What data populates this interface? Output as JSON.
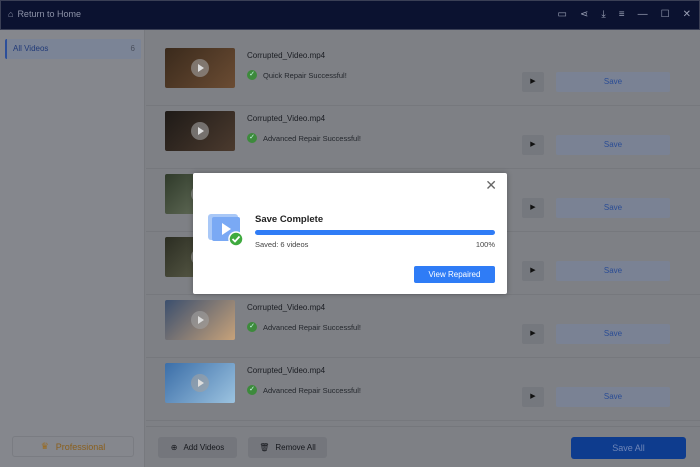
{
  "titlebar": {
    "home_label": "Return to Home",
    "icons": [
      "feedback-icon",
      "share-icon",
      "download-icon",
      "menu-icon",
      "minimize-icon",
      "maximize-icon",
      "close-icon"
    ]
  },
  "sidebar": {
    "all_videos_label": "All Videos",
    "all_videos_count": "6",
    "professional_label": "Professional"
  },
  "videos": [
    {
      "name": "Corrupted_Video.mp4",
      "status": "Quick Repair Successful!",
      "save": "Save"
    },
    {
      "name": "Corrupted_Video.mp4",
      "status": "Advanced Repair Successful!",
      "save": "Save"
    },
    {
      "name": "",
      "status": "",
      "save": "Save"
    },
    {
      "name": "",
      "status": "",
      "save": "Save"
    },
    {
      "name": "Corrupted_Video.mp4",
      "status": "Advanced Repair Successful!",
      "save": "Save"
    },
    {
      "name": "Corrupted_Video.mp4",
      "status": "Advanced Repair Successful!",
      "save": "Save"
    }
  ],
  "footer": {
    "add_videos": "Add Videos",
    "remove_all": "Remove All",
    "save_all": "Save All"
  },
  "modal": {
    "title": "Save Complete",
    "saved_text": "Saved: 6 videos",
    "progress_percent": 100,
    "progress_label": "100%",
    "button": "View Repaired"
  },
  "colors": {
    "accent": "#2f7cf6",
    "success": "#3faa3f"
  }
}
